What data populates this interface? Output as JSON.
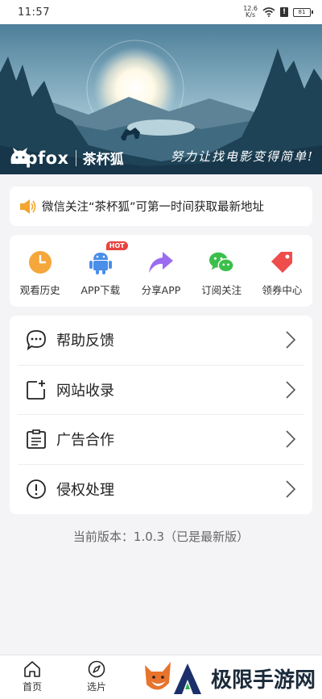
{
  "status_bar": {
    "time": "11:57",
    "net_speed_top": "12.6",
    "net_speed_bottom": "K/s",
    "battery": "81"
  },
  "banner": {
    "brand_en": "upfox",
    "brand_cn": "茶杯狐",
    "slogan": "努力让找电影变得简单!"
  },
  "notice": {
    "icon": "speaker-icon",
    "text": "微信关注“茶杯狐”可第一时间获取最新地址"
  },
  "quick_actions": [
    {
      "label": "观看历史",
      "icon": "clock-icon",
      "color": "#f5a73b"
    },
    {
      "label": "APP下载",
      "icon": "android-icon",
      "color": "#4a8ee8",
      "badge": "HOT"
    },
    {
      "label": "分享APP",
      "icon": "share-icon",
      "color": "#9b6bf0"
    },
    {
      "label": "订阅关注",
      "icon": "wechat-icon",
      "color": "#3bbf4a"
    },
    {
      "label": "领券中心",
      "icon": "coupon-icon",
      "color": "#ef4c4c"
    }
  ],
  "menu": [
    {
      "label": "帮助反馈",
      "icon": "chat-bubble-icon"
    },
    {
      "label": "网站收录",
      "icon": "add-page-icon"
    },
    {
      "label": "广告合作",
      "icon": "document-icon"
    },
    {
      "label": "侵权处理",
      "icon": "exclamation-icon"
    }
  ],
  "version": "当前版本：1.0.3（已是最新版）",
  "tabbar": [
    {
      "label": "首页",
      "icon": "home-icon"
    },
    {
      "label": "选片",
      "icon": "compass-icon"
    }
  ],
  "watermark": {
    "text": "极限手游网"
  }
}
